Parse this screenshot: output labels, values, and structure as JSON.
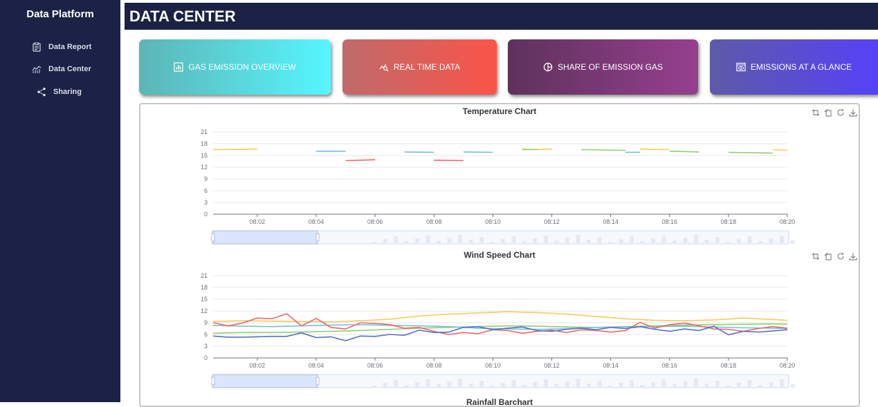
{
  "sidebar": {
    "title": "Data Platform",
    "items": [
      {
        "label": "Data Report",
        "icon": "clipboard-icon"
      },
      {
        "label": "Data Center",
        "icon": "line-chart-icon"
      },
      {
        "label": "Sharing",
        "icon": "share-icon"
      }
    ]
  },
  "header": {
    "title": "DATA CENTER"
  },
  "cards": [
    {
      "label": "GAS EMISSION OVERVIEW",
      "icon": "bar-chart-icon",
      "colors": [
        "#5cb5b5",
        "#56f6ff"
      ]
    },
    {
      "label": "REAL TIME DATA",
      "icon": "trend-search-icon",
      "colors": [
        "#bf6a6a",
        "#fb5449"
      ]
    },
    {
      "label": "SHARE OF EMISSION GAS",
      "icon": "pie-chart-icon",
      "colors": [
        "#5e325c",
        "#963f8e"
      ]
    },
    {
      "label": "EMISSIONS AT A GLANCE",
      "icon": "eye-box-icon",
      "colors": [
        "#5e5aa8",
        "#5542f7"
      ]
    }
  ],
  "colors": {
    "sidebar": "#1b2245",
    "green": "#91cc75",
    "yellow": "#fac858",
    "red": "#ee6666",
    "blue": "#5470c6",
    "cyan": "#73c0de"
  },
  "toolbox_icons": [
    "zoom-icon",
    "zoom-reset-icon",
    "restore-icon",
    "download-icon"
  ],
  "chart_data": [
    {
      "type": "line",
      "title": "Temperature Chart",
      "x_ticks": [
        "08:02",
        "08:04",
        "08:06",
        "08:08",
        "08:10",
        "08:12",
        "08:14",
        "08:16",
        "08:18",
        "08:20"
      ],
      "ylim": [
        0,
        21
      ],
      "y_ticks": [
        0,
        3,
        6,
        9,
        12,
        15,
        18,
        21
      ],
      "grid": true,
      "x_range_minutes": [
        0.5,
        20
      ],
      "series": [
        {
          "color": "#fac858",
          "segments": [
            [
              [
                0.5,
                16.5
              ],
              [
                2.0,
                16.6
              ]
            ],
            [
              [
                11.0,
                16.5
              ],
              [
                12.0,
                16.6
              ]
            ],
            [
              [
                15.0,
                16.6
              ],
              [
                16.0,
                16.5
              ]
            ],
            [
              [
                19.5,
                16.5
              ],
              [
                20.0,
                16.3
              ]
            ]
          ]
        },
        {
          "color": "#73c0de",
          "segments": [
            [
              [
                4.0,
                16.1
              ],
              [
                5.0,
                16.1
              ]
            ],
            [
              [
                7.0,
                15.9
              ],
              [
                8.0,
                15.8
              ]
            ],
            [
              [
                9.0,
                15.9
              ],
              [
                10.0,
                15.8
              ]
            ],
            [
              [
                14.5,
                15.8
              ],
              [
                15.0,
                15.8
              ]
            ]
          ]
        },
        {
          "color": "#ee6666",
          "segments": [
            [
              [
                5.0,
                13.7
              ],
              [
                6.0,
                13.9
              ]
            ],
            [
              [
                8.0,
                13.8
              ],
              [
                9.0,
                13.7
              ]
            ]
          ]
        },
        {
          "color": "#91cc75",
          "segments": [
            [
              [
                11.0,
                16.6
              ],
              [
                11.5,
                16.5
              ]
            ],
            [
              [
                13.0,
                16.5
              ],
              [
                14.5,
                16.3
              ]
            ],
            [
              [
                16.0,
                16.1
              ],
              [
                17.0,
                15.9
              ]
            ],
            [
              [
                18.0,
                15.8
              ],
              [
                19.5,
                15.6
              ]
            ]
          ]
        }
      ]
    },
    {
      "type": "line",
      "title": "Wind Speed Chart",
      "x_ticks": [
        "08:02",
        "08:04",
        "08:06",
        "08:08",
        "08:10",
        "08:12",
        "08:14",
        "08:16",
        "08:18",
        "08:20"
      ],
      "ylim": [
        0,
        21
      ],
      "y_ticks": [
        0,
        3,
        6,
        9,
        12,
        15,
        18,
        21
      ],
      "grid": true,
      "x_range_minutes": [
        0.5,
        20
      ],
      "series": [
        {
          "color": "#fac858",
          "x": [
            0.5,
            1.5,
            2.5,
            3.5,
            4.5,
            5.5,
            6.5,
            7.5,
            8.5,
            9.5,
            10.5,
            11.5,
            12.5,
            13.5,
            14.5,
            15.5,
            16.5,
            17.5,
            18.5,
            19.5,
            20.0
          ],
          "values": [
            9.3,
            9.5,
            9.4,
            9.3,
            9.2,
            9.5,
            9.9,
            10.7,
            11.2,
            11.5,
            11.8,
            11.6,
            11.2,
            10.6,
            10.0,
            9.6,
            9.5,
            9.7,
            10.2,
            9.8,
            9.6
          ]
        },
        {
          "color": "#91cc75",
          "x": [
            0.5,
            1.5,
            2.5,
            3.5,
            4.5,
            5.5,
            6.5,
            7.5,
            8.5,
            9.5,
            10.5,
            11.5,
            12.5,
            13.5,
            14.5,
            15.5,
            16.5,
            17.5,
            18.5,
            19.5,
            20.0
          ],
          "values": [
            6.3,
            6.5,
            6.5,
            6.6,
            6.8,
            7.0,
            7.3,
            7.6,
            7.8,
            8.0,
            8.2,
            8.1,
            7.9,
            7.8,
            8.0,
            8.2,
            8.4,
            8.5,
            8.6,
            8.7,
            8.6
          ]
        },
        {
          "color": "#73c0de",
          "x": [
            0.5,
            1.5,
            2.5,
            3.5,
            4.5,
            5.5,
            6.5,
            7.5,
            8.5,
            9.5,
            10.5,
            11.5,
            12.5,
            13.5,
            14.5,
            15.5,
            16.5,
            17.5,
            18.5,
            19.5,
            20.0
          ],
          "values": [
            8.3,
            8.1,
            8.0,
            8.2,
            8.4,
            8.5,
            8.3,
            8.2,
            8.0,
            7.6,
            7.4,
            7.3,
            7.5,
            7.8,
            7.9,
            8.0,
            8.1,
            7.9,
            7.7,
            7.6,
            7.5
          ]
        },
        {
          "color": "#ee6666",
          "x": [
            0.5,
            1.0,
            1.5,
            2.0,
            2.5,
            3.0,
            3.5,
            4.0,
            4.5,
            5.0,
            5.5,
            6.0,
            6.5,
            7.0,
            7.5,
            8.0,
            8.5,
            9.0,
            9.5,
            10.0,
            10.5,
            11.0,
            11.5,
            12.0,
            12.5,
            13.0,
            13.5,
            14.0,
            14.5,
            15.0,
            15.5,
            16.0,
            16.5,
            17.0,
            17.5,
            18.0,
            18.5,
            19.0,
            19.5,
            20.0
          ],
          "values": [
            9.0,
            8.2,
            8.9,
            10.2,
            10.0,
            11.3,
            8.2,
            10.1,
            7.8,
            7.4,
            9.0,
            8.8,
            8.5,
            7.6,
            7.8,
            6.8,
            6.0,
            6.5,
            6.2,
            7.2,
            7.0,
            6.3,
            6.8,
            7.1,
            6.5,
            7.2,
            7.0,
            6.6,
            7.0,
            9.1,
            7.6,
            8.5,
            8.9,
            8.2,
            7.4,
            7.3,
            6.8,
            7.5,
            8.0,
            7.6
          ]
        },
        {
          "color": "#5470c6",
          "x": [
            0.5,
            1.0,
            1.5,
            2.0,
            2.5,
            3.0,
            3.5,
            4.0,
            4.5,
            5.0,
            5.5,
            6.0,
            6.5,
            7.0,
            7.5,
            8.0,
            8.5,
            9.0,
            9.5,
            10.0,
            10.5,
            11.0,
            11.5,
            12.0,
            12.5,
            13.0,
            13.5,
            14.0,
            14.5,
            15.0,
            15.5,
            16.0,
            16.5,
            17.0,
            17.5,
            18.0,
            18.5,
            19.0,
            19.5,
            20.0
          ],
          "values": [
            5.6,
            5.3,
            5.3,
            5.4,
            5.5,
            5.5,
            6.4,
            5.2,
            5.4,
            4.4,
            5.6,
            5.5,
            6.0,
            5.8,
            7.1,
            6.5,
            6.6,
            7.8,
            8.0,
            7.2,
            7.6,
            7.9,
            7.0,
            6.8,
            7.3,
            7.6,
            7.2,
            7.8,
            7.5,
            8.0,
            7.3,
            6.8,
            7.4,
            7.0,
            8.1,
            5.9,
            6.8,
            6.6,
            6.9,
            7.2
          ]
        }
      ]
    },
    {
      "type": "bar",
      "title": "Rainfall Barchart"
    }
  ]
}
